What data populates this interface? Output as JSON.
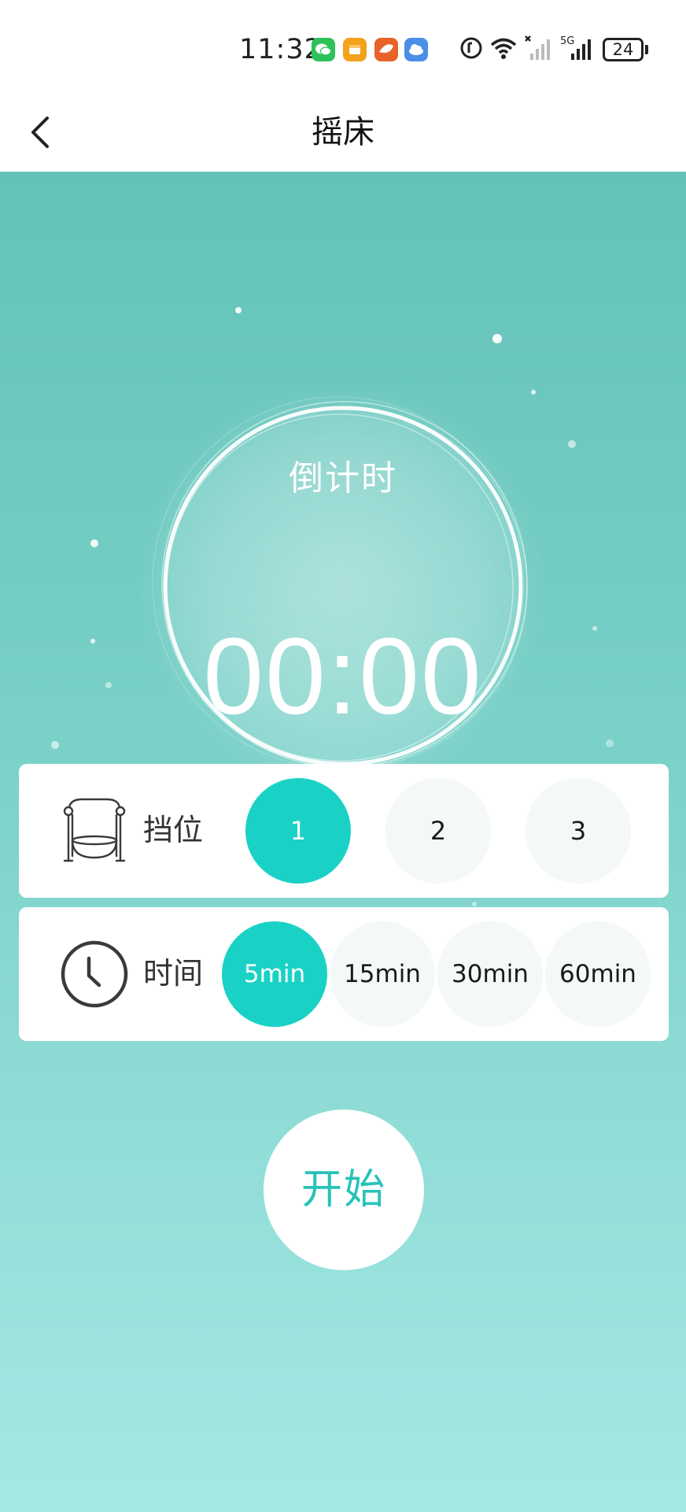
{
  "status_bar": {
    "time": "11:32",
    "battery": "24",
    "network": "5G",
    "notification_icons": [
      "wechat-icon",
      "app-orange-icon",
      "app-red-icon",
      "cloud-icon"
    ],
    "system_icons": [
      "hd-call-icon",
      "wifi-icon",
      "signal-muted-icon",
      "signal-5g-icon",
      "battery-icon"
    ]
  },
  "header": {
    "title": "摇床",
    "back_icon": "chevron-left-icon"
  },
  "timer": {
    "label": "倒计时",
    "value": "00:00"
  },
  "gear": {
    "label": "挡位",
    "icon": "swing-bed-icon",
    "options": [
      "1",
      "2",
      "3"
    ],
    "selected": "1"
  },
  "duration": {
    "label": "时间",
    "icon": "clock-icon",
    "options": [
      "5min",
      "15min",
      "30min",
      "60min"
    ],
    "selected": "5min"
  },
  "start_button": {
    "label": "开始"
  },
  "colors": {
    "accent": "#19d2c5",
    "start_text": "#27c3b7",
    "background_top": "#63c2b8",
    "background_bottom": "#a6e8e4"
  }
}
